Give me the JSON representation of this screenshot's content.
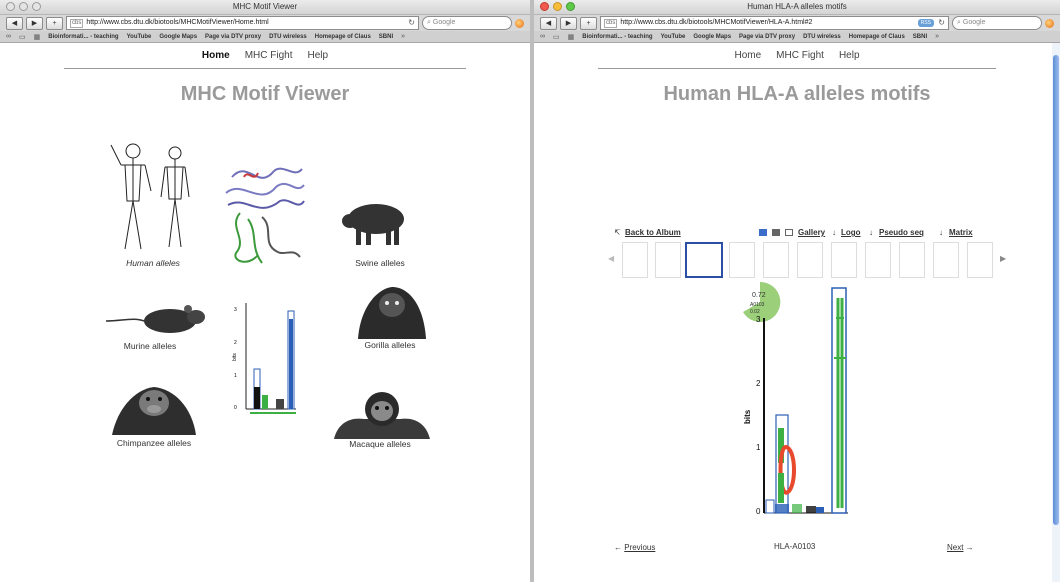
{
  "left_window": {
    "title": "MHC Motif Viewer",
    "url": "http://www.cbs.dtu.dk/biotools/MHCMotifViewer/Home.html",
    "search_placeholder": "Google",
    "bookmarks": [
      "Bioinformati... - teaching",
      "YouTube",
      "Google Maps",
      "Page via DTV proxy",
      "DTU wireless",
      "Homepage of Claus",
      "SBNI"
    ],
    "nav": [
      "Home",
      "MHC Fight",
      "Help"
    ],
    "page_title": "MHC Motif Viewer",
    "categories": [
      "Human alleles",
      "Swine alleles",
      "Murine alleles",
      "Gorilla alleles",
      "Chimpanzee alleles",
      "Macaque alleles"
    ],
    "mini_logo": {
      "ylabel": "bits",
      "ticks": [
        "3",
        "2",
        "1",
        "0"
      ]
    }
  },
  "right_window": {
    "title": "Human HLA-A alleles motifs",
    "url": "http://www.cbs.dtu.dk/biotools/MHCMotifViewer/HLA-A.html#2",
    "rss_label": "RSS",
    "search_placeholder": "Google",
    "bookmarks": [
      "Bioinformati... - teaching",
      "YouTube",
      "Google Maps",
      "Page via DTV proxy",
      "DTU wireless",
      "Homepage of Claus",
      "SBNI"
    ],
    "nav": [
      "Home",
      "MHC Fight",
      "Help"
    ],
    "page_title": "Human HLA-A alleles motifs",
    "back_link": "Back to Album",
    "view_options": [
      "Gallery",
      "Logo",
      "Pseudo seq",
      "Matrix"
    ],
    "pie_value": "0.72",
    "pie_allele": "A0103",
    "pie_small": "0.02",
    "logo_ylabel": "bits",
    "logo_ticks": [
      "3",
      "2",
      "1",
      "0"
    ],
    "previous_label": "Previous",
    "allele_name": "HLA-A0103",
    "next_label": "Next"
  },
  "colors": {
    "title_gray": "#9a9a9a",
    "logo_blue": "#2b5fb5",
    "logo_green": "#3cb043",
    "logo_red": "#e8482b",
    "pie_green": "#9bcf7a"
  }
}
